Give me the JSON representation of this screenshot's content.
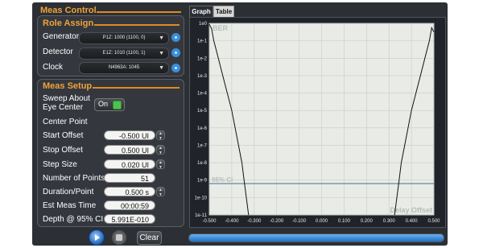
{
  "meas_control": {
    "title": "Meas Control"
  },
  "role_assign": {
    "title": "Role Assign",
    "rows": [
      {
        "label": "Generator",
        "value": "P1Z: 1000 (1100, 0)"
      },
      {
        "label": "Detector",
        "value": "E1Z: 1010 (1100, 1)"
      },
      {
        "label": "Clock",
        "value": "N4963A: 1045"
      }
    ]
  },
  "meas_setup": {
    "title": "Meas Setup",
    "sweep_label": "Sweep About Eye Center",
    "sweep_l1": "Sweep About",
    "sweep_l2": "Eye Center",
    "sweep_toggle": "On",
    "center_point": "Center Point",
    "start_offset": {
      "label": "Start Offset",
      "value": "-0.500 UI"
    },
    "stop_offset": {
      "label": "Stop Offset",
      "value": "0.500 UI"
    },
    "step_size": {
      "label": "Step Size",
      "value": "0.020 UI"
    },
    "num_points": {
      "label": "Number of Points",
      "value": "51"
    },
    "duration": {
      "label": "Duration/Point",
      "value": "0.500 s"
    },
    "est_time": {
      "label": "Est Meas Time",
      "value": "00:00:59"
    },
    "depth": {
      "label": "Depth @ 95% CI",
      "value": "5.991E-010"
    }
  },
  "tabs": [
    {
      "label": "Graph",
      "active": true
    },
    {
      "label": "Table",
      "active": false
    }
  ],
  "bottom": {
    "clear_label": "Clear",
    "progress": 1.0
  },
  "colors": {
    "accent": "#e08a1e",
    "title": "#f0a23a",
    "curve": "#111111",
    "ci_line": "#3a6f9a",
    "plot_bg": "#e9ece6"
  },
  "icons": {
    "play": "play-icon",
    "stop": "stop-icon",
    "gear": "gear-icon"
  },
  "chart_data": {
    "type": "line",
    "title": "BER",
    "xlabel": "Delay Offset",
    "ylabel": "",
    "xlim": [
      -0.5,
      0.5
    ],
    "ylim_exponent": [
      -11,
      0
    ],
    "y_scale": "log",
    "x_ticks": [
      "-0.500",
      "-0.400",
      "-0.300",
      "-0.200",
      "-0.100",
      "0.000",
      "0.100",
      "0.200",
      "0.300",
      "0.400",
      "0.500"
    ],
    "y_ticks": [
      "1e0",
      "1e-1",
      "1e-2",
      "1e-3",
      "1e-4",
      "1e-5",
      "1e-6",
      "1e-7",
      "1e-8",
      "1e-9",
      "1e-10",
      "1e-11"
    ],
    "ci_label": "95% CI",
    "ci_exponent": -9.2,
    "grid": true,
    "series": [
      {
        "points": [
          [
            -0.5,
            -0.05
          ],
          [
            -0.49,
            -0.3
          ],
          [
            -0.48,
            -1.0
          ],
          [
            -0.46,
            -2.0
          ],
          [
            -0.44,
            -3.0
          ],
          [
            -0.42,
            -4.0
          ],
          [
            -0.4,
            -5.0
          ],
          [
            -0.385,
            -6.0
          ],
          [
            -0.37,
            -7.0
          ],
          [
            -0.355,
            -8.0
          ],
          [
            -0.345,
            -9.0
          ],
          [
            -0.335,
            -10.0
          ],
          [
            -0.325,
            -11.0
          ]
        ]
      },
      {
        "points": [
          [
            0.325,
            -11.0
          ],
          [
            0.335,
            -10.0
          ],
          [
            0.345,
            -9.0
          ],
          [
            0.355,
            -8.0
          ],
          [
            0.37,
            -7.0
          ],
          [
            0.385,
            -6.0
          ],
          [
            0.4,
            -5.0
          ],
          [
            0.42,
            -4.0
          ],
          [
            0.44,
            -3.0
          ],
          [
            0.46,
            -2.0
          ],
          [
            0.48,
            -1.0
          ],
          [
            0.49,
            -0.25
          ],
          [
            0.5,
            -0.5
          ]
        ]
      }
    ]
  }
}
